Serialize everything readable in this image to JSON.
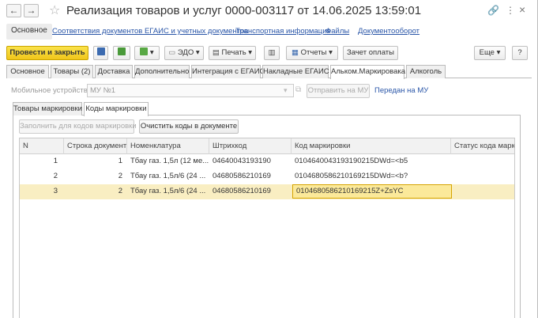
{
  "window": {
    "title": "Реализация товаров и услуг 0000-003117 от 14.06.2025 13:59:01",
    "back_glyph": "←",
    "forward_glyph": "→",
    "star_glyph": "☆",
    "link_glyph": "🔗",
    "more_glyph": "⋮",
    "close_glyph": "×"
  },
  "linkbar": {
    "main": "Основное",
    "links": [
      "Соответствия документов ЕГАИС и учетных документов",
      "Транспортная информация",
      "Файлы",
      "Документооборот"
    ]
  },
  "toolbar": {
    "post_and_close": "Провести и закрыть",
    "edo": "ЭДО",
    "print": "Печать",
    "reports": "Отчеты",
    "offset_payment": "Зачет оплаты",
    "more": "Еще",
    "help": "?",
    "dropdown_glyph": "▾"
  },
  "tabs": [
    "Основное",
    "Товары (2)",
    "Доставка",
    "Дополнительно",
    "Интеграция с ЕГАИС",
    "Накладные ЕГАИС",
    "Альком.Маркировака",
    "Алкоголь"
  ],
  "device": {
    "label": "Мобильное устройство:",
    "value": "МУ №1",
    "send_button": "Отправить на МУ",
    "sent_link": "Передан на МУ"
  },
  "subtabs": [
    "Товары маркировки",
    "Коды маркировки"
  ],
  "actions": {
    "fill_button": "Заполнить для кодов маркировки",
    "clear_button": "Очистить коды в документе"
  },
  "table": {
    "columns": [
      "N",
      "Строка документа",
      "Номенклатура",
      "Штрихкод",
      "Код маркировки",
      "Статус кода маркировки"
    ],
    "rows": [
      [
        "1",
        "1",
        "Тбау газ. 1,5л (12 ме...",
        "04640043193190",
        "0104640043193190215DWd=<b5",
        ""
      ],
      [
        "2",
        "2",
        "Тбау газ. 1,5л/6  (24 ...",
        "04680586210169",
        "0104680586210169215DWd=<b?",
        ""
      ],
      [
        "3",
        "2",
        "Тбау газ. 1,5л/6  (24 ...",
        "04680586210169",
        "0104680586210169215Z+ZsYC",
        ""
      ]
    ],
    "selected_row": 3
  }
}
